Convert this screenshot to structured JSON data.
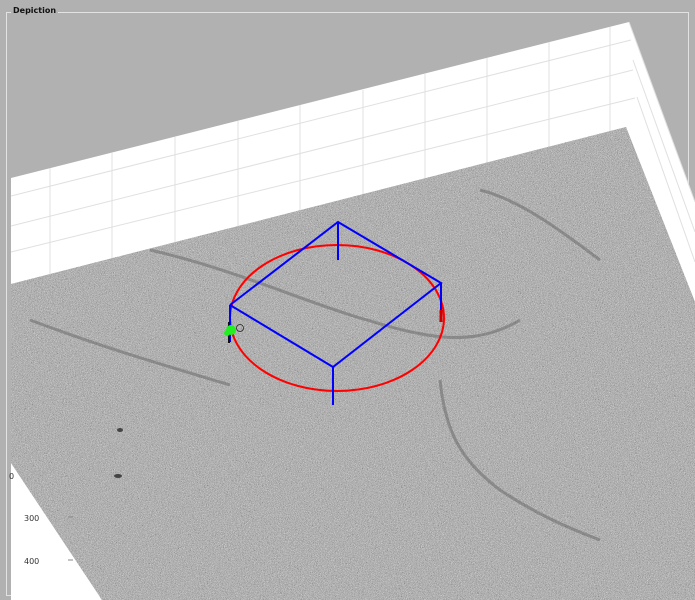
{
  "panel": {
    "title": "Depiction"
  },
  "axes": {
    "y_ticks": [
      {
        "label": "300",
        "value": 300
      },
      {
        "label": "400",
        "value": 400
      }
    ],
    "partial_tick_label": "0"
  },
  "colors": {
    "background": "#b1b1b1",
    "axes_wall": "#ffffff",
    "grid": "#dedede",
    "image_plane": "#9c9c9c",
    "box_edges": "#0000ff",
    "ellipse": "#ff0000",
    "marker": "#22ee22"
  },
  "icons": [
    "ring-marker-icon"
  ]
}
